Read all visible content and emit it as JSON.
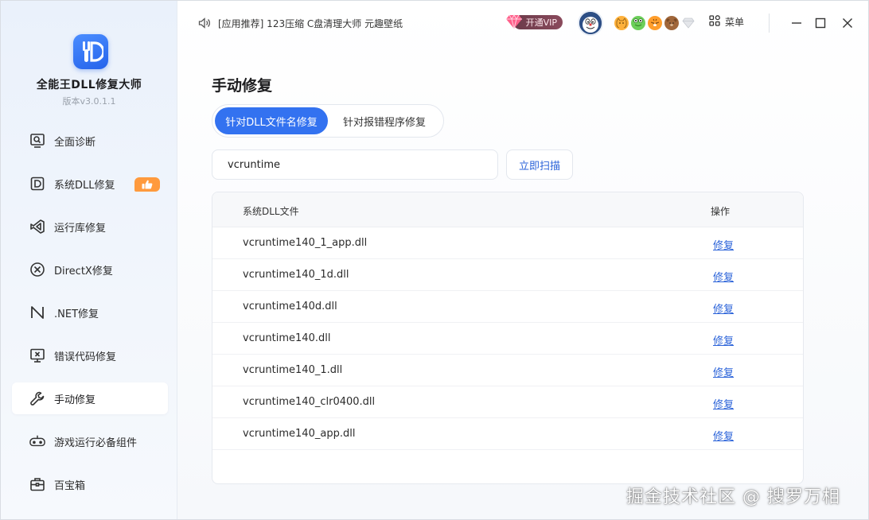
{
  "app": {
    "name": "全能王DLL修复大师",
    "version": "版本v3.0.1.1"
  },
  "sidebar": {
    "items": [
      {
        "label": "全面诊断",
        "icon": "diagnose-icon",
        "active": false
      },
      {
        "label": "系统DLL修复",
        "icon": "dll-icon",
        "active": false,
        "badge": "thumbs-up-icon"
      },
      {
        "label": "运行库修复",
        "icon": "runtime-icon",
        "active": false
      },
      {
        "label": "DirectX修复",
        "icon": "directx-icon",
        "active": false
      },
      {
        "label": ".NET修复",
        "icon": "dotnet-icon",
        "active": false
      },
      {
        "label": "错误代码修复",
        "icon": "error-code-icon",
        "active": false
      },
      {
        "label": "手动修复",
        "icon": "wrench-icon",
        "active": true
      },
      {
        "label": "游戏运行必备组件",
        "icon": "gamepad-icon",
        "active": false
      },
      {
        "label": "百宝箱",
        "icon": "toolbox-icon",
        "active": false
      }
    ]
  },
  "topbar": {
    "notice": "[应用推荐] 123压缩 C盘清理大师 元趣壁纸",
    "vip_label": "开通VIP",
    "menu_label": "菜单"
  },
  "main": {
    "title": "手动修复",
    "tabs": [
      {
        "label": "针对DLL文件名修复",
        "active": true
      },
      {
        "label": "针对报错程序修复",
        "active": false
      }
    ],
    "search": {
      "value": "vcruntime",
      "placeholder": ""
    },
    "scan_button": "立即扫描",
    "table": {
      "headers": {
        "file": "系统DLL文件",
        "op": "操作"
      },
      "rows": [
        {
          "file": "vcruntime140_1_app.dll",
          "op": "修复"
        },
        {
          "file": "vcruntime140_1d.dll",
          "op": "修复"
        },
        {
          "file": "vcruntime140d.dll",
          "op": "修复"
        },
        {
          "file": "vcruntime140.dll",
          "op": "修复"
        },
        {
          "file": "vcruntime140_1.dll",
          "op": "修复"
        },
        {
          "file": "vcruntime140_clr0400.dll",
          "op": "修复"
        },
        {
          "file": "vcruntime140_app.dll",
          "op": "修复"
        }
      ]
    }
  },
  "watermark": "掘金技术社区 @ 搜罗万相",
  "colors": {
    "accent": "#3372f0",
    "link": "#2b63d9",
    "badge": "#ff9a3d",
    "vip": "#6b3b4a"
  }
}
